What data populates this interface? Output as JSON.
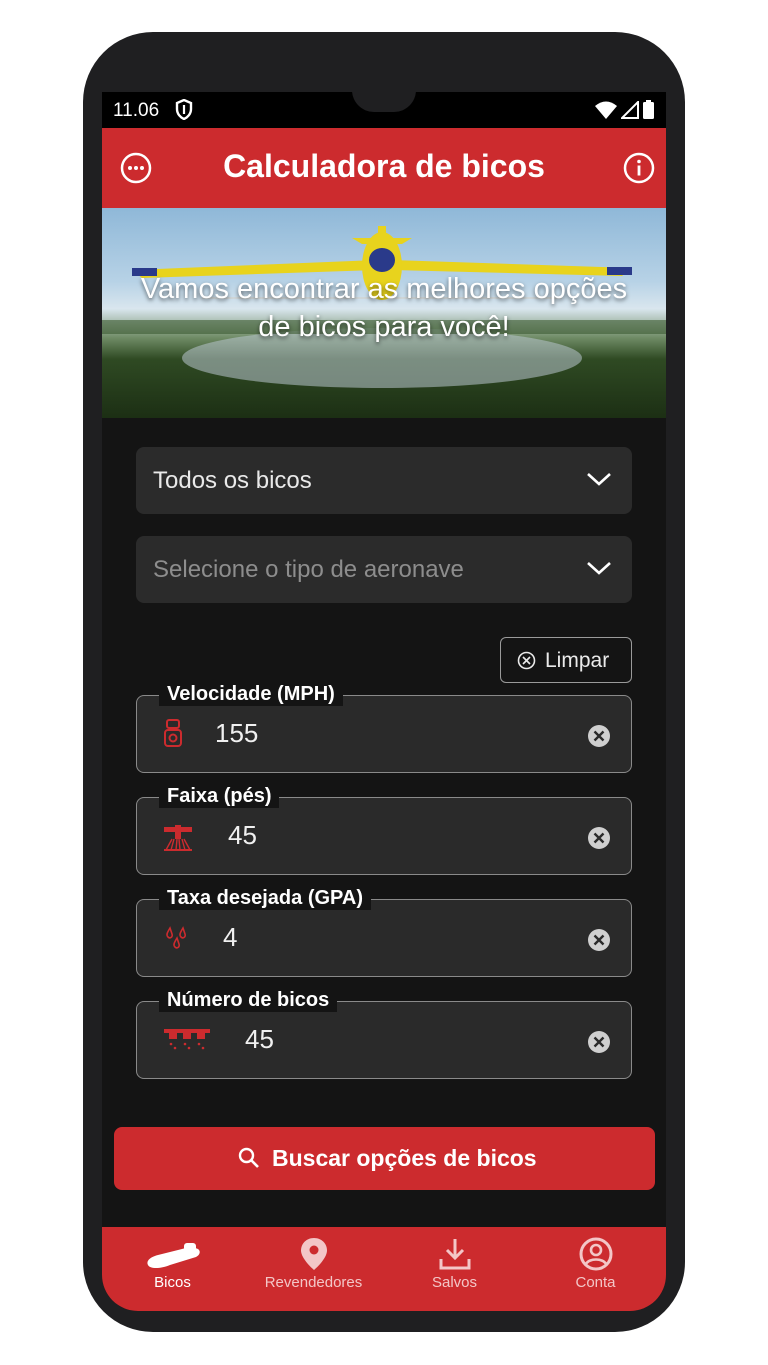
{
  "status": {
    "time": "11.06"
  },
  "appbar": {
    "title": "Calculadora de bicos",
    "menu_icon": "more-horizontal-circle-icon",
    "info_icon": "info-circle-icon"
  },
  "hero": {
    "tagline": "Vamos encontrar as melhores opções de bicos para você!"
  },
  "filters": {
    "nozzle_type": {
      "value": "Todos os bicos"
    },
    "aircraft_type": {
      "placeholder": "Selecione o tipo de aeronave"
    }
  },
  "clear_button": {
    "label": "Limpar"
  },
  "fields": {
    "speed": {
      "label": "Velocidade (MPH)",
      "value": "155",
      "icon": "speedometer-icon"
    },
    "swath": {
      "label": "Faixa (pés)",
      "value": "45",
      "icon": "swath-plane-icon"
    },
    "rate": {
      "label": "Taxa desejada (GPA)",
      "value": "4",
      "icon": "droplets-icon"
    },
    "nozzles": {
      "label": "Número de bicos",
      "value": "45",
      "icon": "boom-nozzles-icon"
    }
  },
  "search_button": {
    "label": "Buscar opções de bicos"
  },
  "nav": {
    "items": [
      {
        "label": "Bicos",
        "icon": "nozzle-icon",
        "active": true
      },
      {
        "label": "Revendedores",
        "icon": "location-pin-icon",
        "active": false
      },
      {
        "label": "Salvos",
        "icon": "download-icon",
        "active": false
      },
      {
        "label": "Conta",
        "icon": "account-circle-icon",
        "active": false
      }
    ]
  },
  "colors": {
    "brand_red": "#cc2b2e",
    "background": "#141414",
    "field_bg": "#2a2a2a"
  }
}
